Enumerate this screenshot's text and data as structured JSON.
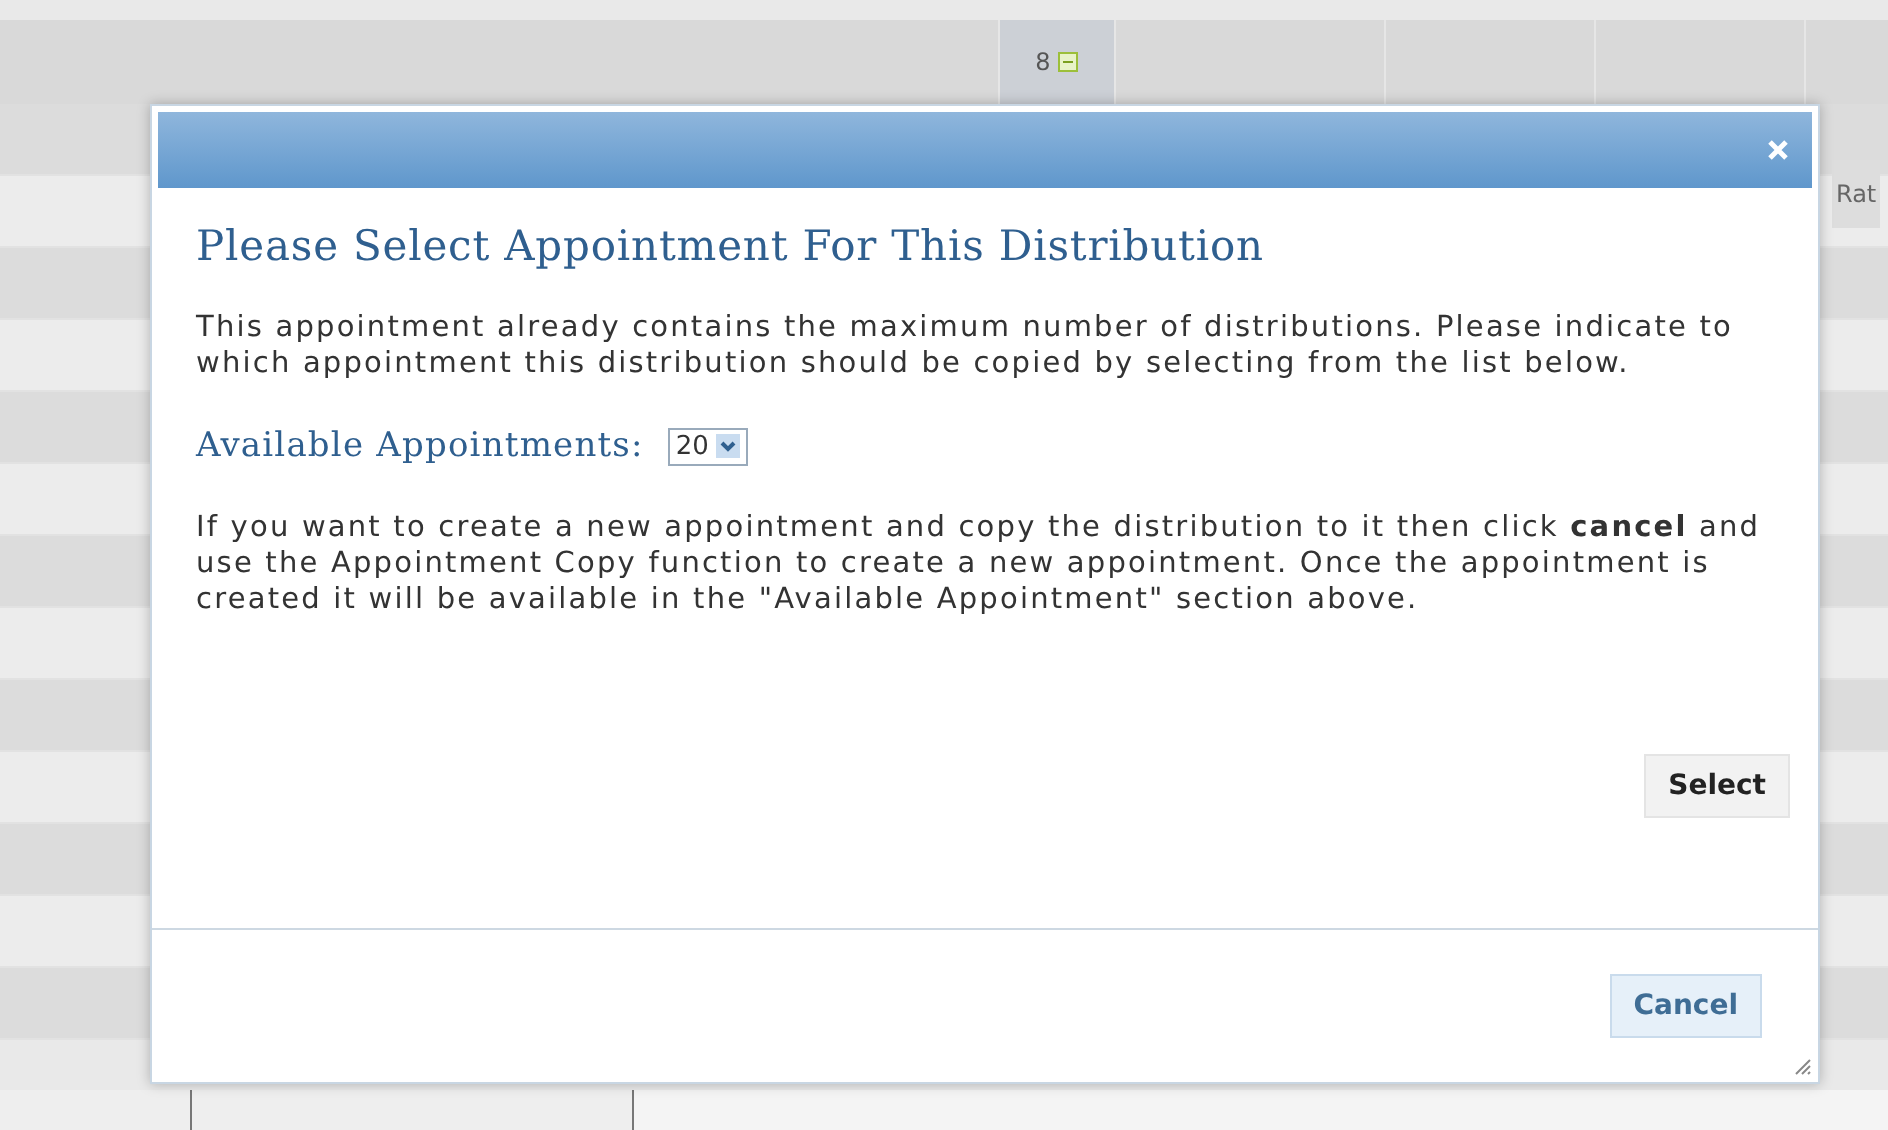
{
  "background": {
    "count_cell": "8",
    "column_header": "Rat"
  },
  "dialog": {
    "title": "Please Select Appointment For This Distribution",
    "intro": "This appointment already contains the maximum number of distributions. Please indicate to which appointment this distribution should be copied by selecting from the list below.",
    "field": {
      "label": "Available Appointments:",
      "value": "20"
    },
    "note": "If you want to create a new appointment and copy the distribution to it then click **cancel** and use the Appointment Copy function to create a new appointment. Once the appointment is created it will be available in the \"Available Appointment\" section above.",
    "buttons": [
      {
        "label": "Select",
        "kind": "body"
      },
      {
        "label": "Cancel",
        "kind": "footer"
      }
    ]
  }
}
